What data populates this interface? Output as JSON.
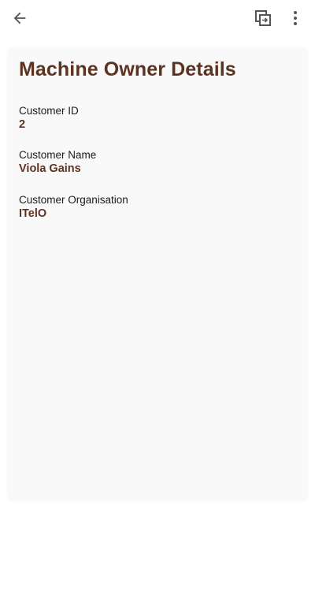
{
  "header": {
    "back_icon": "arrow-left-icon",
    "copy_icon": "copy-icon",
    "more_icon": "more-vertical-icon"
  },
  "card": {
    "title": "Machine Owner Details",
    "fields": [
      {
        "label": "Customer ID",
        "value": "2"
      },
      {
        "label": "Customer Name",
        "value": "Viola Gains"
      },
      {
        "label": "Customer Organisation",
        "value": "ITelO"
      }
    ]
  },
  "colors": {
    "accent": "#5b3320",
    "card_background": "#f9f9f9",
    "icon": "#555555"
  }
}
